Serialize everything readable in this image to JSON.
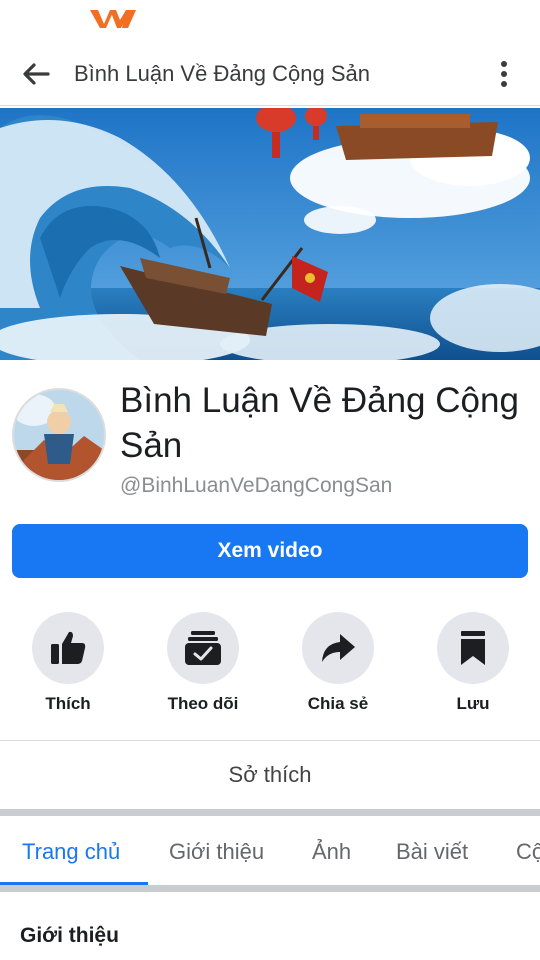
{
  "app_bar": {
    "title": "Bình Luận Về Đảng Cộng Sản"
  },
  "profile": {
    "name": "Bình Luận Về Đảng Cộng Sản",
    "handle": "@BinhLuanVeDangCongSan"
  },
  "primary_action": {
    "label": "Xem video"
  },
  "actions": [
    {
      "label": "Thích",
      "icon": "thumbs-up-icon"
    },
    {
      "label": "Theo dõi",
      "icon": "follow-inbox-icon"
    },
    {
      "label": "Chia sẻ",
      "icon": "share-arrow-icon"
    },
    {
      "label": "Lưu",
      "icon": "bookmark-icon"
    }
  ],
  "interests": {
    "label": "Sở thích"
  },
  "tabs": [
    {
      "label": "Trang chủ",
      "active": true
    },
    {
      "label": "Giới thiệu",
      "active": false
    },
    {
      "label": "Ảnh",
      "active": false
    },
    {
      "label": "Bài viết",
      "active": false
    },
    {
      "label": "Cộ",
      "active": false
    }
  ],
  "section": {
    "title": "Giới thiệu"
  },
  "colors": {
    "accent": "#1877f2",
    "carrier_logo": "#f26f21"
  }
}
